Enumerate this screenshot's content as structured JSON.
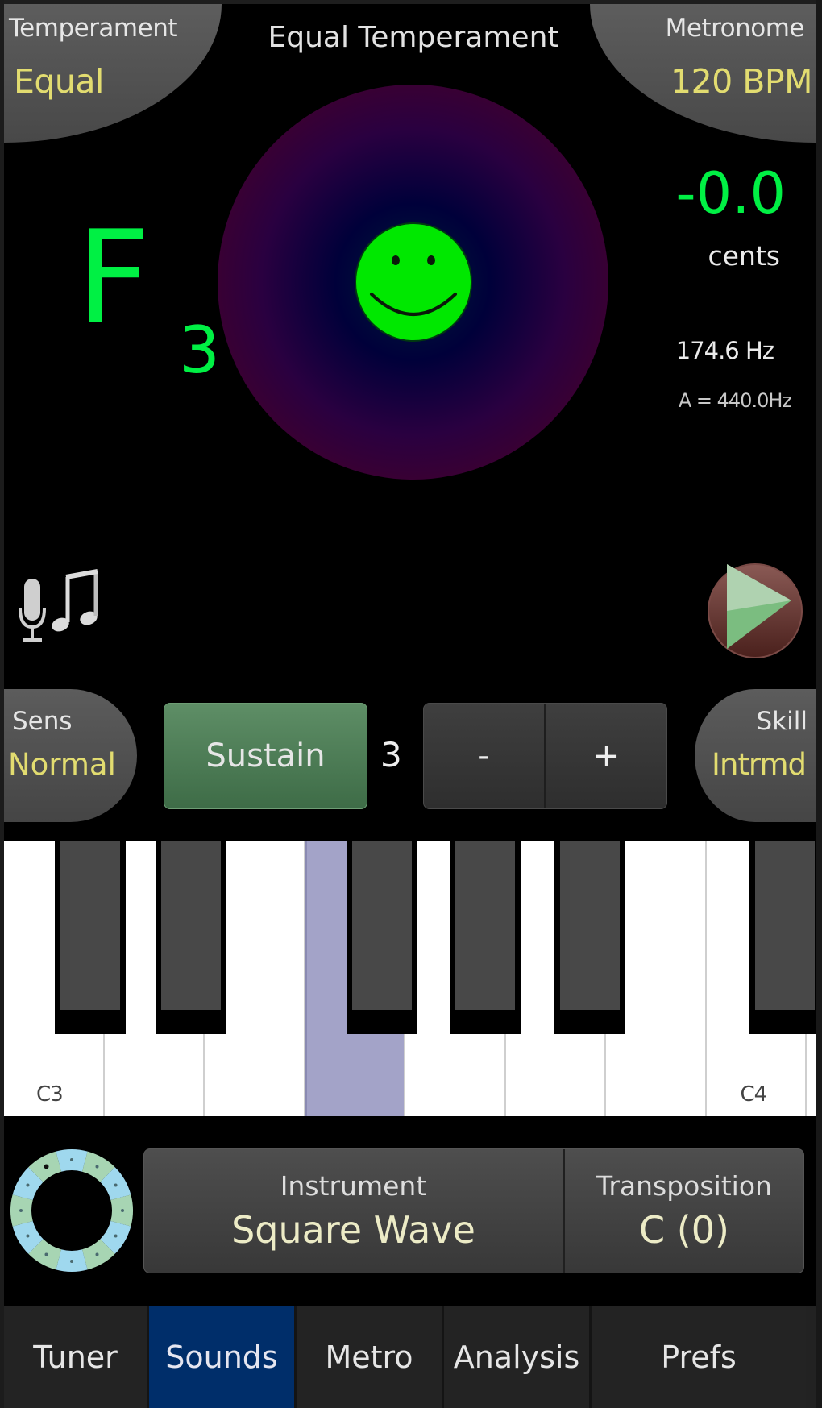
{
  "header": {
    "temperament": {
      "label": "Temperament",
      "value": "Equal"
    },
    "metronome": {
      "label": "Metronome",
      "value": "120 BPM"
    },
    "title": "Equal Temperament"
  },
  "tuner": {
    "note": "F",
    "octave": "3",
    "cents_value": "-0.0",
    "cents_label": "cents",
    "frequency": "174.6 Hz",
    "reference": "A = 440.0Hz",
    "status_face": "smiley-in-tune",
    "colors": {
      "note": "#00f044",
      "face": "#00e800"
    }
  },
  "input_icons": {
    "mic": "microphone-icon",
    "music": "music-note-icon"
  },
  "play": {
    "icon": "play-icon"
  },
  "controls": {
    "sensitivity": {
      "label": "Sens",
      "value": "Normal"
    },
    "sustain_label": "Sustain",
    "sustain_count": "3",
    "decrement_label": "-",
    "increment_label": "+",
    "skill": {
      "label": "Skill",
      "value": "Intrmd"
    }
  },
  "keyboard": {
    "white_keys": [
      {
        "note": "C3",
        "label": "C3",
        "active": false
      },
      {
        "note": "D3",
        "label": "",
        "active": false
      },
      {
        "note": "E3",
        "label": "",
        "active": false
      },
      {
        "note": "F3",
        "label": "",
        "active": true
      },
      {
        "note": "G3",
        "label": "",
        "active": false
      },
      {
        "note": "A3",
        "label": "",
        "active": false
      },
      {
        "note": "B3",
        "label": "",
        "active": false
      },
      {
        "note": "C4",
        "label": "C4",
        "active": false
      },
      {
        "note": "D4",
        "label": "",
        "active": false
      }
    ],
    "black_keys": [
      "C#3",
      "D#3",
      "F#3",
      "G#3",
      "A#3",
      "C#4"
    ],
    "active_color": "#a3a3c8"
  },
  "instrument_bar": {
    "wheel_icon": "circle-of-fifths-icon",
    "instrument": {
      "label": "Instrument",
      "value": "Square Wave"
    },
    "transposition": {
      "label": "Transposition",
      "value": "C (0)"
    }
  },
  "tabs": [
    {
      "label": "Tuner",
      "active": false
    },
    {
      "label": "Sounds",
      "active": true
    },
    {
      "label": "Metro",
      "active": false
    },
    {
      "label": "Analysis",
      "active": false
    },
    {
      "label": "Prefs",
      "active": false
    }
  ]
}
